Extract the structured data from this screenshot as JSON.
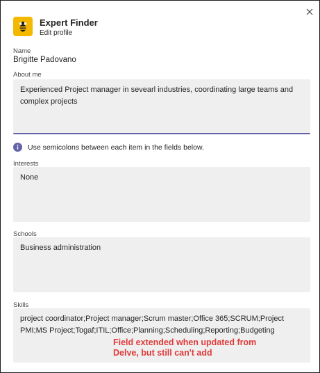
{
  "header": {
    "app_title": "Expert Finder",
    "app_subtitle": "Edit profile",
    "app_icon": "bee-icon",
    "close_icon": "close-icon"
  },
  "form": {
    "name_label": "Name",
    "name_value": "Brigitte Padovano",
    "about_label": "About me",
    "about_value": "Experienced Project manager in sevearl industries, coordinating large teams and complex projects",
    "info_text": "Use semicolons between each item in the fields below.",
    "interests_label": "Interests",
    "interests_value": "None",
    "schools_label": "Schools",
    "schools_value": "Business administration",
    "skills_label": "Skills",
    "skills_value": "project coordinator;Project manager;Scrum master;Office 365;SCRUM;Project PMI;MS Project;Togaf;ITIL;Office;Planning;Scheduling;Reporting;Budgeting"
  },
  "annotation": {
    "line1": "Field extended when updated from",
    "line2": "Delve,  but still can't add"
  },
  "colors": {
    "accent": "#6264a7",
    "icon_bg": "#f5b800",
    "annotation": "#e03a3a",
    "field_bg": "#efefef"
  }
}
